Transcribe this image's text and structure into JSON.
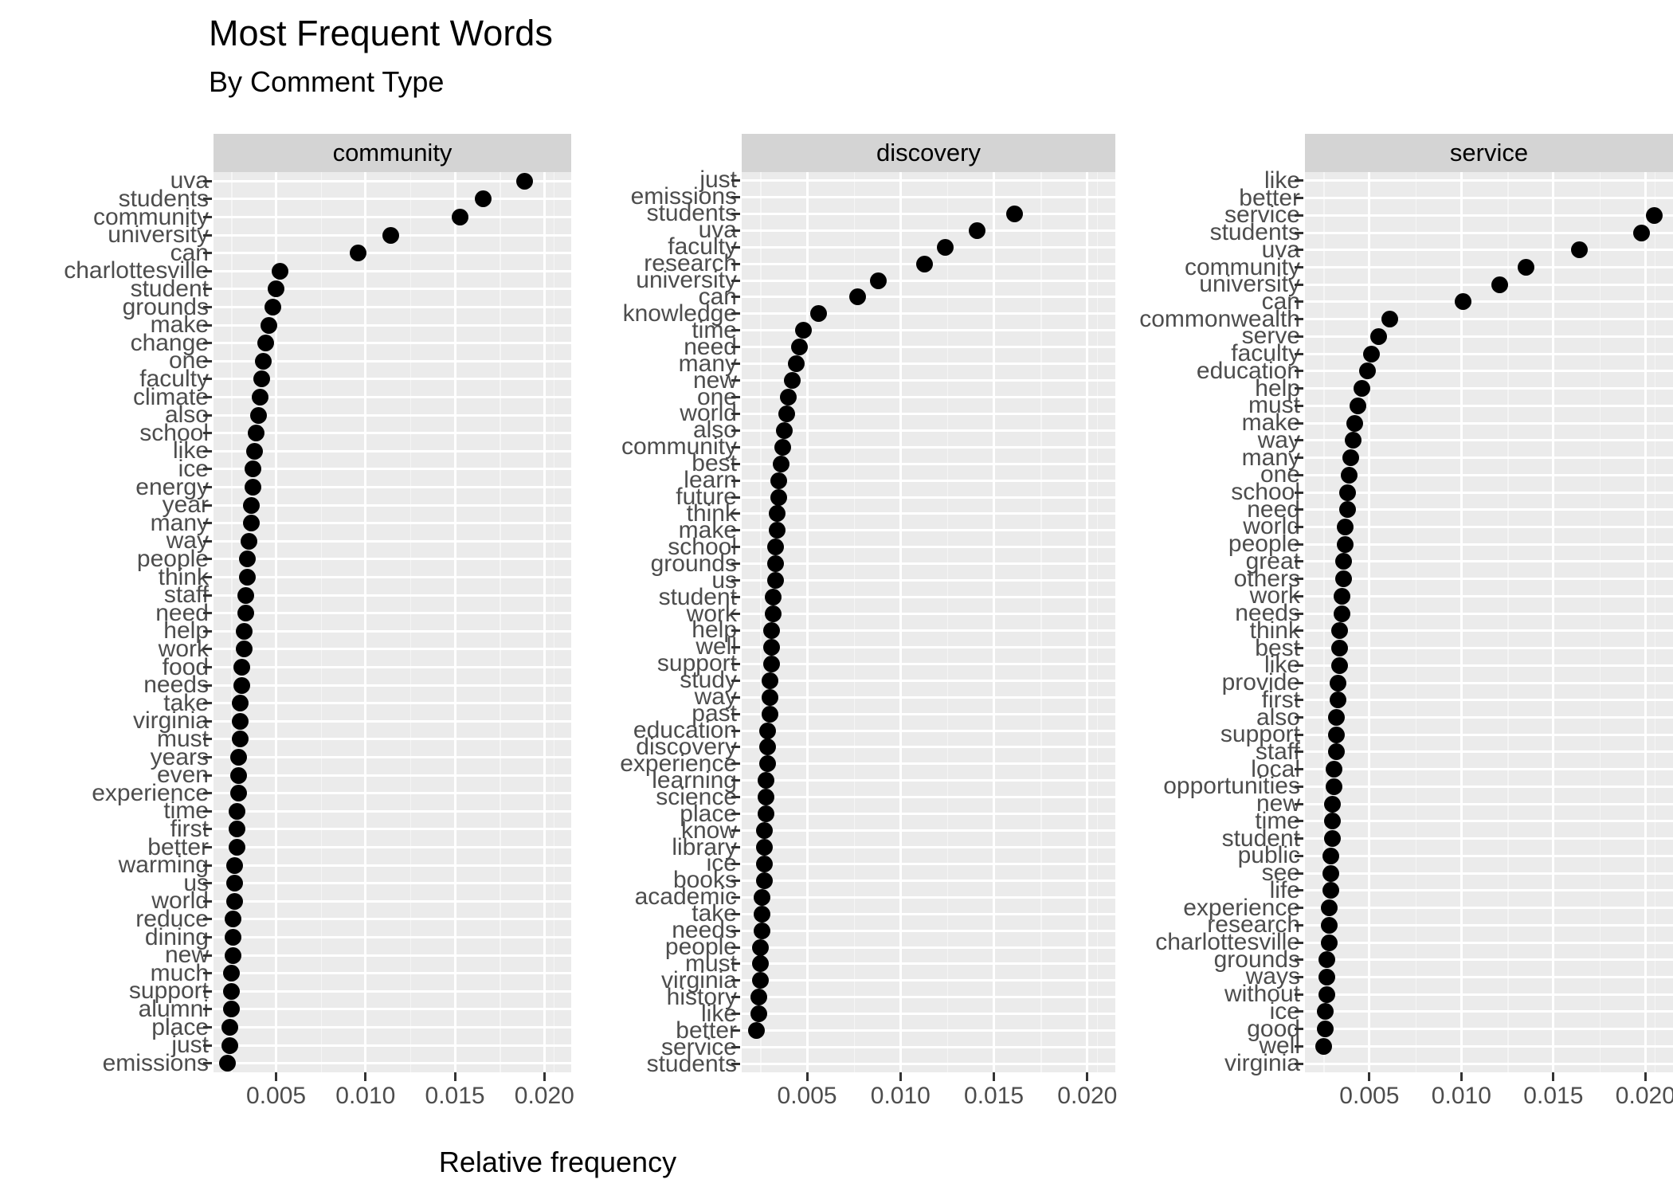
{
  "header": {
    "title": "Most Frequent Words",
    "subtitle": "By Comment Type"
  },
  "chart_data": {
    "type": "scatter",
    "title": "Most Frequent Words",
    "subtitle": "By Comment Type",
    "xlabel": "Relative frequency",
    "ylabel": "",
    "xlim": [
      0.0015,
      0.0215
    ],
    "xticks": [
      0.005,
      0.01,
      0.015,
      0.02
    ],
    "xticklabels": [
      "0.005",
      "0.010",
      "0.015",
      "0.020"
    ],
    "grid": true,
    "legend": false,
    "facet_variable": "Comment Type",
    "panels": [
      {
        "label": "community",
        "categories": [
          "uva",
          "students",
          "community",
          "university",
          "can",
          "charlottesville",
          "student",
          "grounds",
          "make",
          "change",
          "one",
          "faculty",
          "climate",
          "also",
          "school",
          "like",
          "ice",
          "energy",
          "year",
          "many",
          "way",
          "people",
          "think",
          "staff",
          "need",
          "help",
          "work",
          "food",
          "needs",
          "take",
          "virginia",
          "must",
          "years",
          "even",
          "experience",
          "time",
          "first",
          "better",
          "warming",
          "us",
          "world",
          "reduce",
          "dining",
          "new",
          "much",
          "support",
          "alumni",
          "place",
          "just",
          "emissions"
        ],
        "values": [
          0.0189,
          0.0166,
          0.0153,
          0.0114,
          0.0096,
          0.0052,
          0.005,
          0.0048,
          0.0046,
          0.0044,
          0.0043,
          0.0042,
          0.0041,
          0.004,
          0.0039,
          0.0038,
          0.0037,
          0.0037,
          0.0036,
          0.0036,
          0.0035,
          0.0034,
          0.0034,
          0.0033,
          0.0033,
          0.0032,
          0.0032,
          0.0031,
          0.0031,
          0.003,
          0.003,
          0.003,
          0.0029,
          0.0029,
          0.0029,
          0.0028,
          0.0028,
          0.0028,
          0.0027,
          0.0027,
          0.0027,
          0.0026,
          0.0026,
          0.0026,
          0.0025,
          0.0025,
          0.0025,
          0.0024,
          0.0024,
          0.0023
        ]
      },
      {
        "label": "discovery",
        "categories": [
          "just",
          "emissions",
          "students",
          "uva",
          "faculty",
          "research",
          "university",
          "can",
          "knowledge",
          "time",
          "need",
          "many",
          "new",
          "one",
          "world",
          "also",
          "community",
          "best",
          "learn",
          "future",
          "think",
          "make",
          "school",
          "grounds",
          "us",
          "student",
          "work",
          "help",
          "well",
          "support",
          "study",
          "way",
          "past",
          "education",
          "discovery",
          "experience",
          "learning",
          "science",
          "place",
          "know",
          "library",
          "ice",
          "books",
          "academic",
          "take",
          "needs",
          "people",
          "must",
          "virginia",
          "history",
          "like",
          "better",
          "service",
          "students"
        ],
        "values": [
          null,
          null,
          0.0161,
          0.0141,
          0.0124,
          0.0113,
          0.0088,
          0.0077,
          0.0056,
          0.0048,
          0.0046,
          0.0044,
          0.0042,
          0.004,
          0.0039,
          0.0038,
          0.0037,
          0.0036,
          0.0035,
          0.0035,
          0.0034,
          0.0034,
          0.0033,
          0.0033,
          0.0033,
          0.0032,
          0.0032,
          0.0031,
          0.0031,
          0.0031,
          0.003,
          0.003,
          0.003,
          0.0029,
          0.0029,
          0.0029,
          0.0028,
          0.0028,
          0.0028,
          0.0027,
          0.0027,
          0.0027,
          0.0027,
          0.0026,
          0.0026,
          0.0026,
          0.0025,
          0.0025,
          0.0025,
          0.0024,
          0.0024,
          0.0023,
          null,
          null
        ]
      },
      {
        "label": "service",
        "categories": [
          "like",
          "better",
          "service",
          "students",
          "uva",
          "community",
          "university",
          "can",
          "commonwealth",
          "serve",
          "faculty",
          "education",
          "help",
          "must",
          "make",
          "way",
          "many",
          "one",
          "school",
          "need",
          "world",
          "people",
          "great",
          "others",
          "work",
          "needs",
          "think",
          "best",
          "like",
          "provide",
          "first",
          "also",
          "support",
          "staff",
          "local",
          "opportunities",
          "new",
          "time",
          "student",
          "public",
          "see",
          "life",
          "experience",
          "research",
          "charlottesville",
          "grounds",
          "ways",
          "without",
          "ice",
          "good",
          "well",
          "virginia"
        ],
        "values": [
          null,
          null,
          0.0205,
          0.0198,
          0.0164,
          0.0135,
          0.0121,
          0.0101,
          0.0061,
          0.0055,
          0.0051,
          0.0049,
          0.0046,
          0.0044,
          0.0042,
          0.0041,
          0.004,
          0.0039,
          0.0038,
          0.0038,
          0.0037,
          0.0037,
          0.0036,
          0.0036,
          0.0035,
          0.0035,
          0.0034,
          0.0034,
          0.0034,
          0.0033,
          0.0033,
          0.0032,
          0.0032,
          0.0032,
          0.0031,
          0.0031,
          0.003,
          0.003,
          0.003,
          0.0029,
          0.0029,
          0.0029,
          0.0028,
          0.0028,
          0.0028,
          0.0027,
          0.0027,
          0.0027,
          0.0026,
          0.0026,
          0.0025,
          null
        ]
      }
    ]
  },
  "colors": {
    "panel_background": "#ebebeb",
    "strip_background": "#d4d4d4",
    "gridline": "#ffffff",
    "point": "#000000",
    "axis_text": "#4d4d4d"
  }
}
